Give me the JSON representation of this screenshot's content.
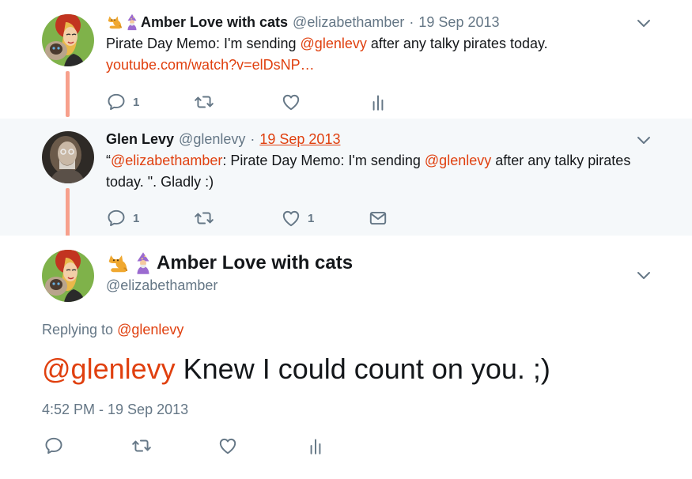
{
  "tweets": [
    {
      "display_name": "Amber Love with cats",
      "handle": "@elizabethamber",
      "separator": "·",
      "date": "19 Sep 2013",
      "text_pre": "Pirate Day Memo: I'm sending ",
      "mention": "@glenlevy",
      "text_post": " after any talky pirates today.",
      "url": "youtube.com/watch?v=elDsNP…",
      "reply_count": "1"
    },
    {
      "display_name": "Glen Levy",
      "handle": "@glenlevy",
      "separator": "·",
      "date": "19 Sep 2013",
      "quote_open": "“",
      "mention_1": "@elizabethamber",
      "text_mid": ": Pirate Day Memo: I'm sending ",
      "mention_2": "@glenlevy",
      "text_post": " after any talky pirates today. \". Gladly :)",
      "reply_count": "1",
      "like_count": "1"
    }
  ],
  "focused": {
    "display_name": "Amber Love with cats",
    "handle": "@elizabethamber",
    "replying_label": "Replying to ",
    "replying_to": "@glenlevy",
    "mention": "@glenlevy",
    "text": " Knew I could count on you. ;)",
    "timestamp": "4:52 PM - 19 Sep 2013"
  },
  "colors": {
    "accent": "#e0400f",
    "muted": "#657786",
    "thread_line": "#f7a08c",
    "highlight_bg": "#f5f8fa"
  },
  "icons": [
    "reply-icon",
    "retweet-icon",
    "like-icon",
    "analytics-icon",
    "dm-icon",
    "chevron-down-icon",
    "cat-emoji-icon",
    "mage-emoji-icon"
  ]
}
